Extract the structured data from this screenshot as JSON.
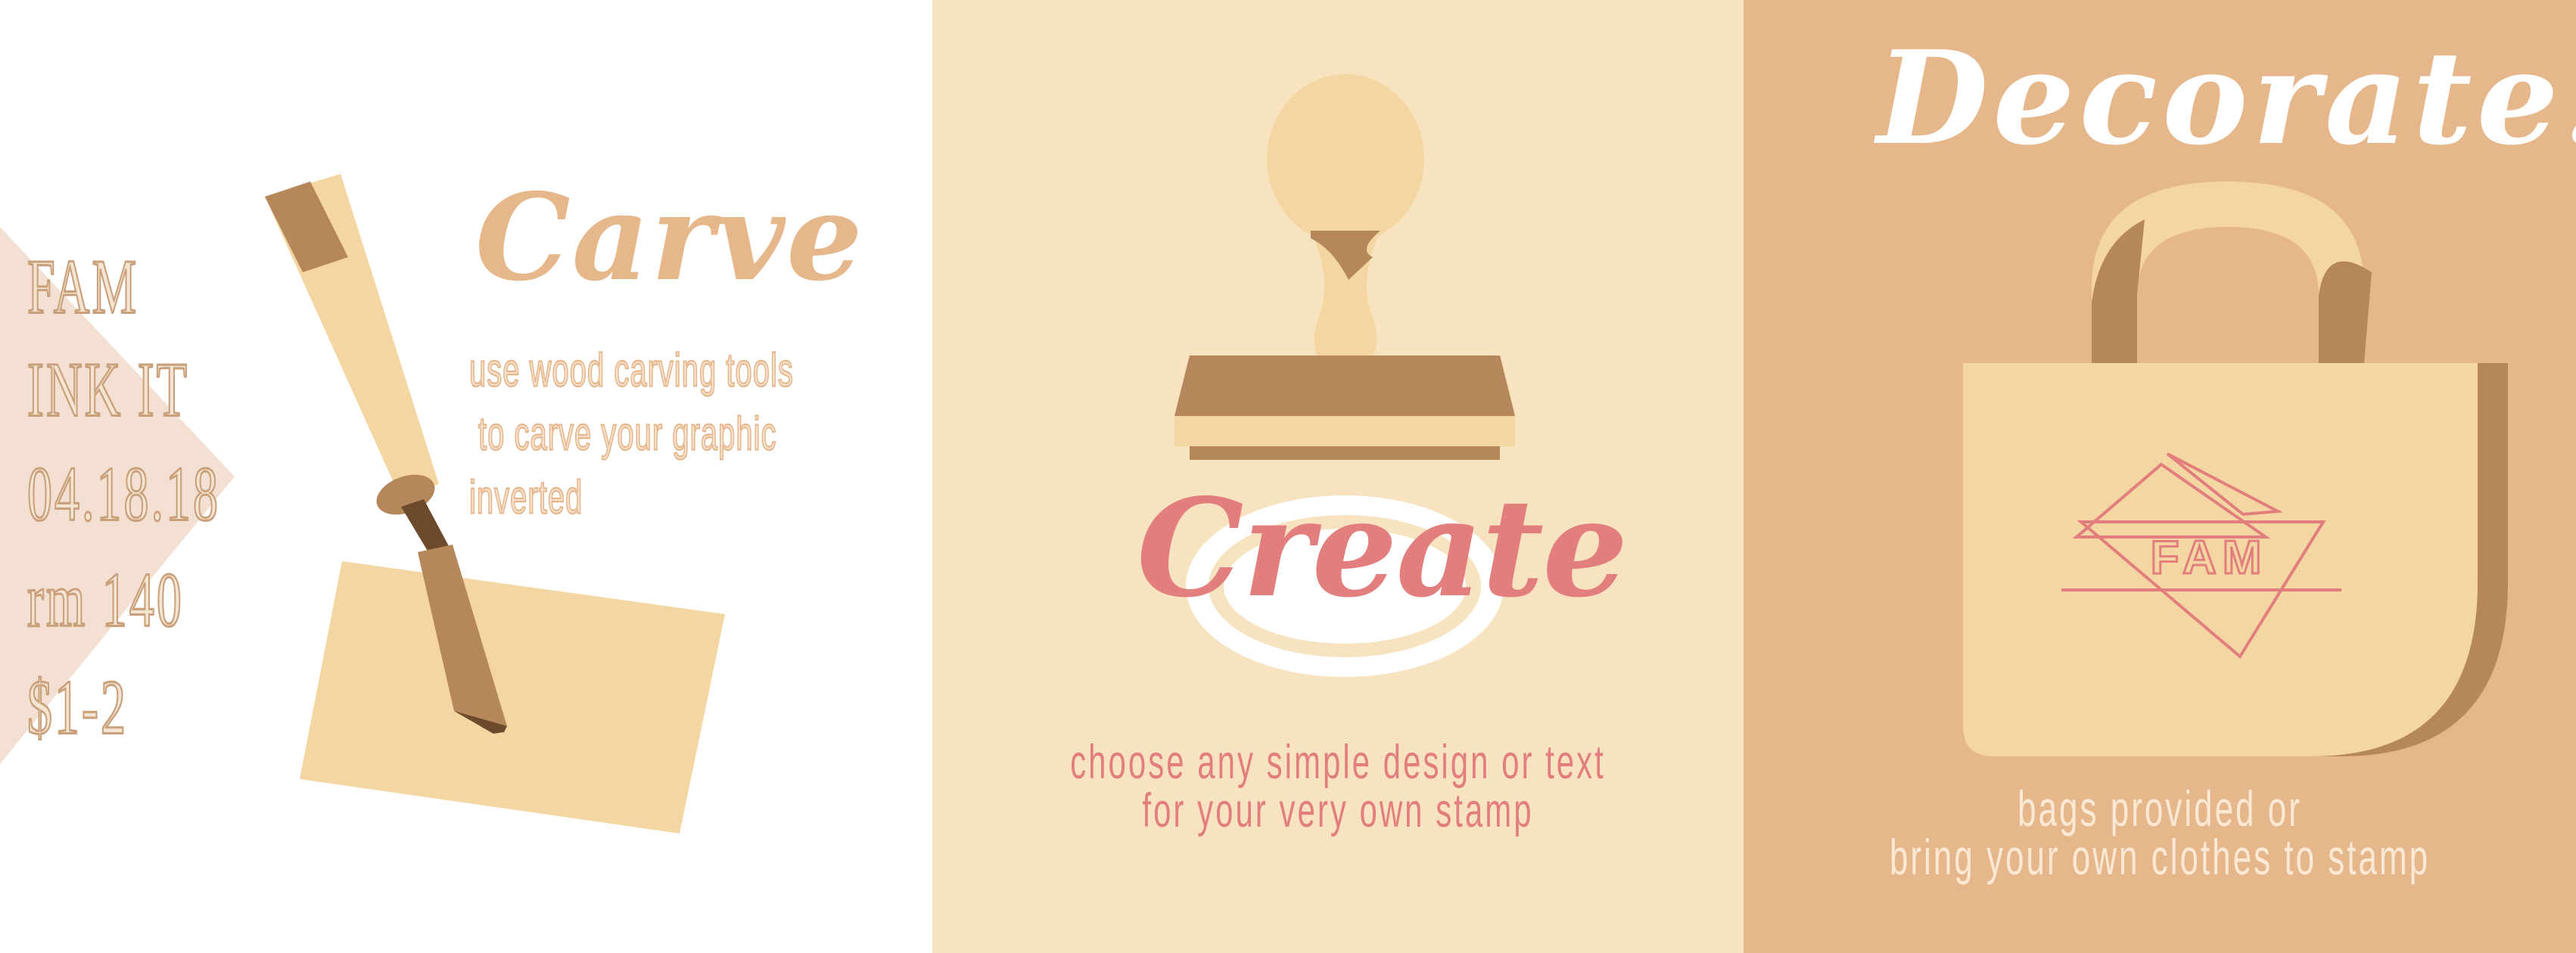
{
  "event_info": {
    "lines": [
      "FAM",
      "INK IT",
      "04.18.18",
      "rm 140",
      "$1-2"
    ]
  },
  "carve": {
    "title": "Carve",
    "description": [
      "use wood carving tools",
      "to carve your graphic",
      "inverted"
    ]
  },
  "create": {
    "title": "Create",
    "description": [
      "choose any simple design or text",
      "for your very own stamp"
    ]
  },
  "decorate": {
    "title": "Decorate!",
    "bag_logo": "FAM",
    "description": [
      "bags provided or",
      "bring your own clothes to stamp"
    ]
  },
  "colors": {
    "cream": "#f8e3c0",
    "peach": "#e6b78a",
    "wood_light": "#f4d6a2",
    "wood_dark": "#b7875c",
    "pink": "#e27f7e",
    "white": "#ffffff"
  }
}
